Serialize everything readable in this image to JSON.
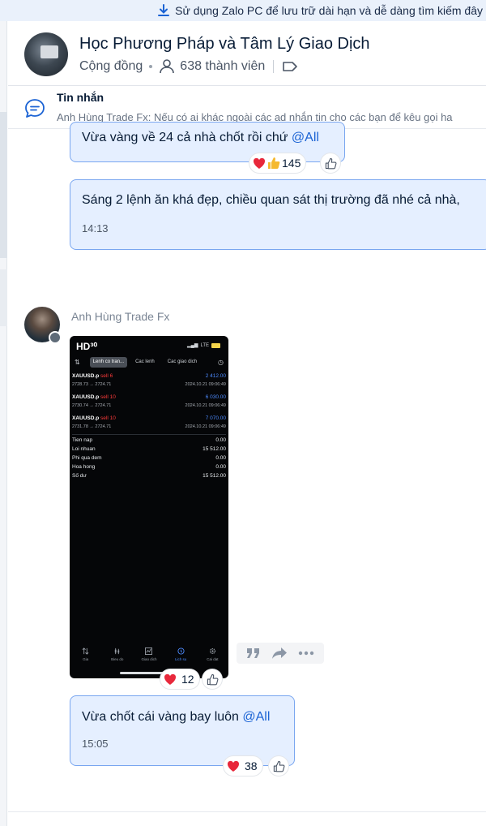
{
  "banner": {
    "text": "Sử dụng Zalo PC để lưu trữ dài hạn và dễ dàng tìm kiếm đây"
  },
  "header": {
    "title": "Học Phương Pháp và Tâm Lý Giao Dịch",
    "type": "Cộng đồng",
    "members": "638 thành viên"
  },
  "pinned": {
    "label": "Tin nhắn",
    "preview": "Anh Hùng Trade Fx: Nếu có ai khác ngoài các ad nhắn tin cho các bạn để kêu gọi ha"
  },
  "messages": {
    "m1": {
      "text": "Vừa vàng về 24 cả nhà chốt rồi chứ ",
      "mention": "@All",
      "reactions": "145"
    },
    "m2": {
      "text": "Sáng 2 lệnh ăn khá đẹp, chiều quan sát thị trường đã nhé cả nhà,",
      "time": "14:13"
    },
    "sender": "Anh Hùng Trade Fx",
    "image": {
      "reactions": "12"
    },
    "m3": {
      "text": "Vừa chốt cái vàng bay luôn ",
      "mention": "@All",
      "time": "15:05",
      "reactions": "38"
    }
  },
  "phone": {
    "status_time": "HD³⁰",
    "status_right": "LTE",
    "battery": "64",
    "tabs": [
      "Lenh co tran...",
      "Cac lenh",
      "Cac giao dich"
    ],
    "orders": [
      {
        "symbol": "XAUUSD.p",
        "side": "sell 6",
        "prices": "2728.73 → 2724.71",
        "profit": "2 412.00",
        "date": "2024.10.21 09:06:49"
      },
      {
        "symbol": "XAUUSD.p",
        "side": "sell 10",
        "prices": "2730.74 → 2724.71",
        "profit": "6 030.00",
        "date": "2024.10.21 09:06:49"
      },
      {
        "symbol": "XAUUSD.p",
        "side": "sell 10",
        "prices": "2731.78 → 2724.71",
        "profit": "7 070.00",
        "date": "2024.10.21 09:06:49"
      }
    ],
    "summary": [
      {
        "label": "Tien nap",
        "value": "0.00"
      },
      {
        "label": "Loi nhuan",
        "value": "15 512.00"
      },
      {
        "label": "Phi qua dem",
        "value": "0.00"
      },
      {
        "label": "Hoa hong",
        "value": "0.00"
      },
      {
        "label": "Số dư",
        "value": "15 512.00"
      }
    ],
    "nav": [
      "Gia",
      "Bieu do",
      "Giao dich",
      "Lich su",
      "Cai dat"
    ]
  },
  "colors": {
    "bubble_bg": "#e5efff",
    "bubble_border": "#79a6f0",
    "mention": "#1b63d4",
    "heart": "#e8283b",
    "thumb": "#f5b92e"
  }
}
